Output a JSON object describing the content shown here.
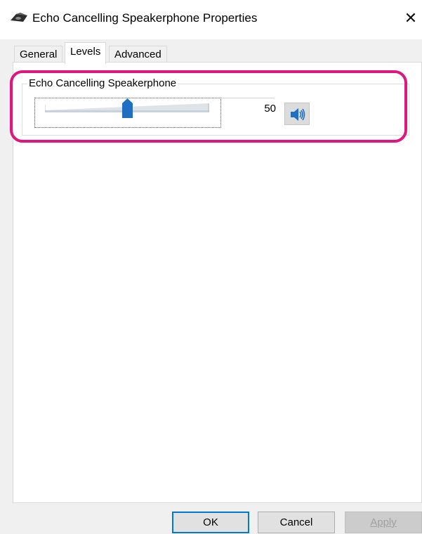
{
  "window": {
    "title": "Echo Cancelling Speakerphone Properties",
    "close_glyph": "✕",
    "icon": "speakerphone-icon"
  },
  "tabs": [
    {
      "label": "General",
      "active": false
    },
    {
      "label": "Levels",
      "active": true
    },
    {
      "label": "Advanced",
      "active": false
    }
  ],
  "levels": {
    "group_label": "Echo Cancelling Speakerphone",
    "slider_value": "50",
    "slider_fraction": 0.5,
    "mute_icon": "speaker-volume-icon"
  },
  "buttons": {
    "ok": "OK",
    "cancel": "Cancel",
    "apply": "Apply"
  },
  "colors": {
    "highlight": "#e0167f",
    "slider_thumb": "#1e6fc2",
    "ok_border": "#0078d7"
  }
}
